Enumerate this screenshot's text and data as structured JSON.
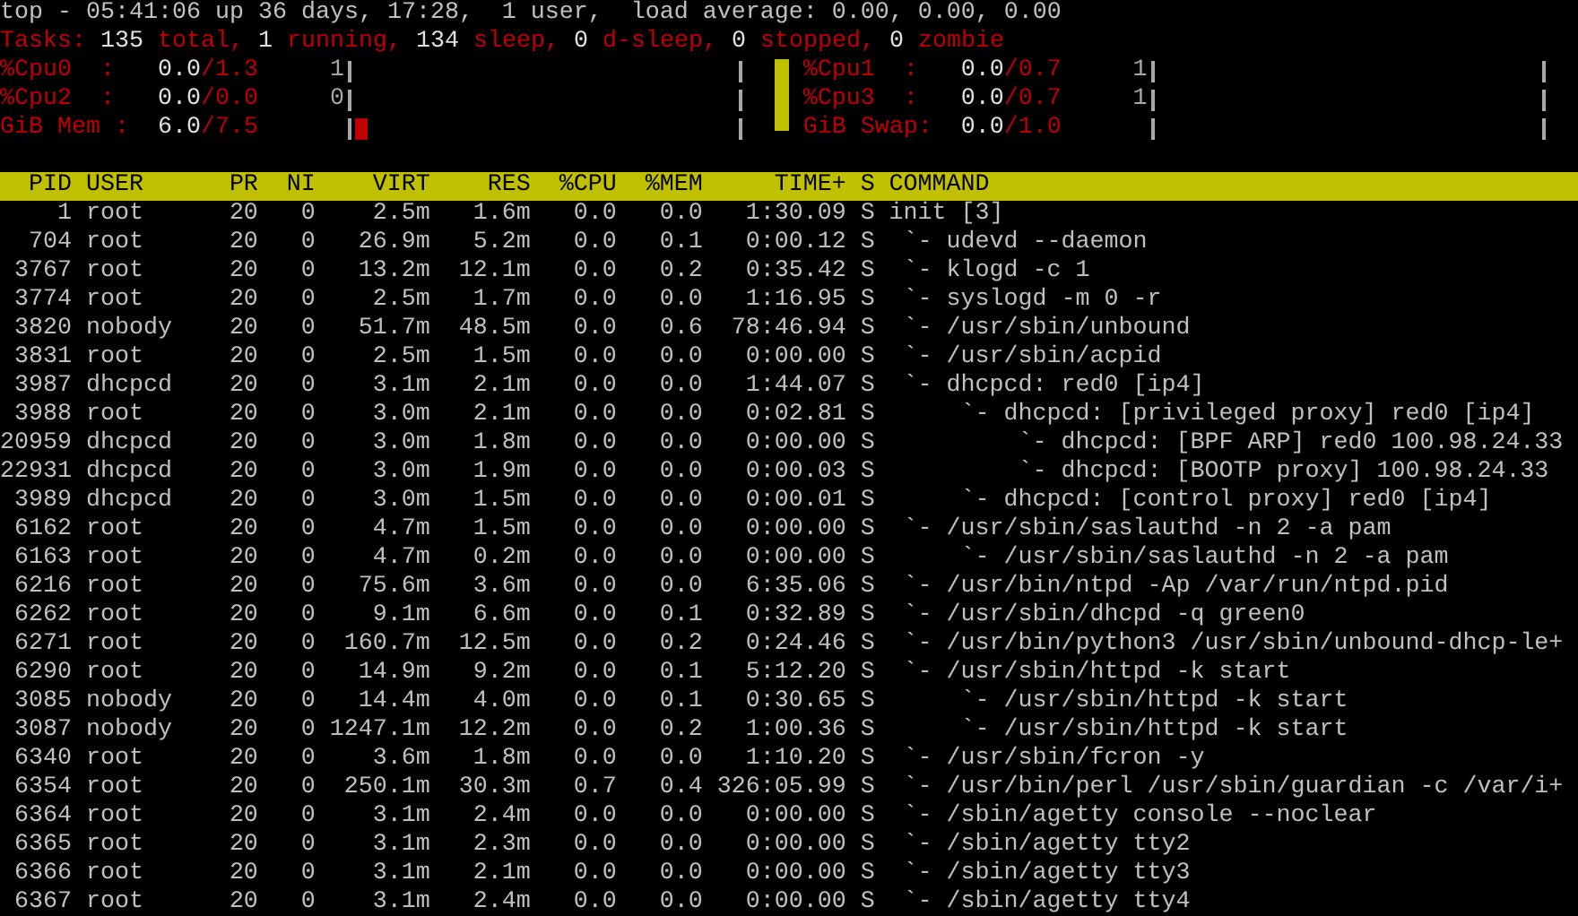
{
  "summary": "top - 05:41:06 up 36 days, 17:28,  1 user,  load average: 0.00, 0.00, 0.00",
  "tasks": {
    "label": "Tasks:",
    "items": [
      {
        "count": "135",
        "text": "total,"
      },
      {
        "count": "1",
        "text": "running,"
      },
      {
        "count": "134",
        "text": "sleep,"
      },
      {
        "count": "0",
        "text": "d-sleep,"
      },
      {
        "count": "0",
        "text": "stopped,"
      },
      {
        "count": "0",
        "text": "zombie"
      }
    ]
  },
  "meters": {
    "left": [
      {
        "label": "%Cpu0  :",
        "value": "0.0",
        "limit": "/1.3",
        "count": "1"
      },
      {
        "label": "%Cpu2  :",
        "value": "0.0",
        "limit": "/0.0",
        "count": "0"
      },
      {
        "label": "GiB Mem :",
        "value": "6.0",
        "limit": "/7.5",
        "level": 0.035
      }
    ],
    "right": [
      {
        "label": "%Cpu1  :",
        "value": "0.0",
        "limit": "/0.7",
        "count": "1"
      },
      {
        "label": "%Cpu3  :",
        "value": "0.0",
        "limit": "/0.7",
        "count": "1"
      },
      {
        "label": "GiB Swap:",
        "value": "0.0",
        "limit": "/1.0"
      }
    ]
  },
  "table": {
    "columns": [
      "PID",
      "USER",
      "PR",
      "NI",
      "VIRT",
      "RES",
      "%CPU",
      "%MEM",
      "TIME+",
      "S",
      "COMMAND"
    ],
    "rows": [
      {
        "pid": "1",
        "user": "root",
        "pr": "20",
        "ni": "0",
        "virt": "2.5m",
        "res": "1.6m",
        "cpu": "0.0",
        "mem": "0.0",
        "time": "1:30.09",
        "s": "S",
        "command": "init [3]",
        "children": [
          {
            "pid": "704",
            "user": "root",
            "pr": "20",
            "ni": "0",
            "virt": "26.9m",
            "res": "5.2m",
            "cpu": "0.0",
            "mem": "0.1",
            "time": "0:00.12",
            "s": "S",
            "command": "`- udevd --daemon"
          },
          {
            "pid": "3767",
            "user": "root",
            "pr": "20",
            "ni": "0",
            "virt": "13.2m",
            "res": "12.1m",
            "cpu": "0.0",
            "mem": "0.2",
            "time": "0:35.42",
            "s": "S",
            "command": "`- klogd -c 1"
          },
          {
            "pid": "3774",
            "user": "root",
            "pr": "20",
            "ni": "0",
            "virt": "2.5m",
            "res": "1.7m",
            "cpu": "0.0",
            "mem": "0.0",
            "time": "1:16.95",
            "s": "S",
            "command": "`- syslogd -m 0 -r"
          },
          {
            "pid": "3820",
            "user": "nobody",
            "pr": "20",
            "ni": "0",
            "virt": "51.7m",
            "res": "48.5m",
            "cpu": "0.0",
            "mem": "0.6",
            "time": "78:46.94",
            "s": "S",
            "command": "`- /usr/sbin/unbound"
          },
          {
            "pid": "3831",
            "user": "root",
            "pr": "20",
            "ni": "0",
            "virt": "2.5m",
            "res": "1.5m",
            "cpu": "0.0",
            "mem": "0.0",
            "time": "0:00.00",
            "s": "S",
            "command": "`- /usr/sbin/acpid"
          },
          {
            "pid": "3987",
            "user": "dhcpcd",
            "pr": "20",
            "ni": "0",
            "virt": "3.1m",
            "res": "2.1m",
            "cpu": "0.0",
            "mem": "0.0",
            "time": "1:44.07",
            "s": "S",
            "command": "`- dhcpcd: red0 [ip4]",
            "children": [
              {
                "pid": "3988",
                "user": "root",
                "pr": "20",
                "ni": "0",
                "virt": "3.0m",
                "res": "2.1m",
                "cpu": "0.0",
                "mem": "0.0",
                "time": "0:02.81",
                "s": "S",
                "command": "`- dhcpcd: [privileged proxy] red0 [ip4]",
                "children": [
                  {
                    "pid": "20959",
                    "user": "dhcpcd",
                    "pr": "20",
                    "ni": "0",
                    "virt": "3.0m",
                    "res": "1.8m",
                    "cpu": "0.0",
                    "mem": "0.0",
                    "time": "0:00.00",
                    "s": "S",
                    "command": "`- dhcpcd: [BPF ARP] red0 100.98.24.33"
                  },
                  {
                    "pid": "22931",
                    "user": "dhcpcd",
                    "pr": "20",
                    "ni": "0",
                    "virt": "3.0m",
                    "res": "1.9m",
                    "cpu": "0.0",
                    "mem": "0.0",
                    "time": "0:00.03",
                    "s": "S",
                    "command": "`- dhcpcd: [BOOTP proxy] 100.98.24.33"
                  }
                ]
              },
              {
                "pid": "3989",
                "user": "dhcpcd",
                "pr": "20",
                "ni": "0",
                "virt": "3.0m",
                "res": "1.5m",
                "cpu": "0.0",
                "mem": "0.0",
                "time": "0:00.01",
                "s": "S",
                "command": "`- dhcpcd: [control proxy] red0 [ip4]"
              }
            ]
          },
          {
            "pid": "6162",
            "user": "root",
            "pr": "20",
            "ni": "0",
            "virt": "4.7m",
            "res": "1.5m",
            "cpu": "0.0",
            "mem": "0.0",
            "time": "0:00.00",
            "s": "S",
            "command": "`- /usr/sbin/saslauthd -n 2 -a pam",
            "children": [
              {
                "pid": "6163",
                "user": "root",
                "pr": "20",
                "ni": "0",
                "virt": "4.7m",
                "res": "0.2m",
                "cpu": "0.0",
                "mem": "0.0",
                "time": "0:00.00",
                "s": "S",
                "command": "`- /usr/sbin/saslauthd -n 2 -a pam"
              }
            ]
          },
          {
            "pid": "6216",
            "user": "root",
            "pr": "20",
            "ni": "0",
            "virt": "75.6m",
            "res": "3.6m",
            "cpu": "0.0",
            "mem": "0.0",
            "time": "6:35.06",
            "s": "S",
            "command": "`- /usr/bin/ntpd -Ap /var/run/ntpd.pid"
          },
          {
            "pid": "6262",
            "user": "root",
            "pr": "20",
            "ni": "0",
            "virt": "9.1m",
            "res": "6.6m",
            "cpu": "0.0",
            "mem": "0.1",
            "time": "0:32.89",
            "s": "S",
            "command": "`- /usr/sbin/dhcpd -q green0"
          },
          {
            "pid": "6271",
            "user": "root",
            "pr": "20",
            "ni": "0",
            "virt": "160.7m",
            "res": "12.5m",
            "cpu": "0.0",
            "mem": "0.2",
            "time": "0:24.46",
            "s": "S",
            "command": "`- /usr/bin/python3 /usr/sbin/unbound-dhcp-le+"
          },
          {
            "pid": "6290",
            "user": "root",
            "pr": "20",
            "ni": "0",
            "virt": "14.9m",
            "res": "9.2m",
            "cpu": "0.0",
            "mem": "0.1",
            "time": "5:12.20",
            "s": "S",
            "command": "`- /usr/sbin/httpd -k start",
            "children": [
              {
                "pid": "3085",
                "user": "nobody",
                "pr": "20",
                "ni": "0",
                "virt": "14.4m",
                "res": "4.0m",
                "cpu": "0.0",
                "mem": "0.1",
                "time": "0:30.65",
                "s": "S",
                "command": "`- /usr/sbin/httpd -k start"
              },
              {
                "pid": "3087",
                "user": "nobody",
                "pr": "20",
                "ni": "0",
                "virt": "1247.1m",
                "res": "12.2m",
                "cpu": "0.0",
                "mem": "0.2",
                "time": "1:00.36",
                "s": "S",
                "command": "`- /usr/sbin/httpd -k start"
              }
            ]
          },
          {
            "pid": "6340",
            "user": "root",
            "pr": "20",
            "ni": "0",
            "virt": "3.6m",
            "res": "1.8m",
            "cpu": "0.0",
            "mem": "0.0",
            "time": "1:10.20",
            "s": "S",
            "command": "`- /usr/sbin/fcron -y"
          },
          {
            "pid": "6354",
            "user": "root",
            "pr": "20",
            "ni": "0",
            "virt": "250.1m",
            "res": "30.3m",
            "cpu": "0.7",
            "mem": "0.4",
            "time": "326:05.99",
            "s": "S",
            "command": "`- /usr/bin/perl /usr/sbin/guardian -c /var/i+"
          },
          {
            "pid": "6364",
            "user": "root",
            "pr": "20",
            "ni": "0",
            "virt": "3.1m",
            "res": "2.4m",
            "cpu": "0.0",
            "mem": "0.0",
            "time": "0:00.00",
            "s": "S",
            "command": "`- /sbin/agetty console --noclear"
          },
          {
            "pid": "6365",
            "user": "root",
            "pr": "20",
            "ni": "0",
            "virt": "3.1m",
            "res": "2.3m",
            "cpu": "0.0",
            "mem": "0.0",
            "time": "0:00.00",
            "s": "S",
            "command": "`- /sbin/agetty tty2"
          },
          {
            "pid": "6366",
            "user": "root",
            "pr": "20",
            "ni": "0",
            "virt": "3.1m",
            "res": "2.1m",
            "cpu": "0.0",
            "mem": "0.0",
            "time": "0:00.00",
            "s": "S",
            "command": "`- /sbin/agetty tty3"
          },
          {
            "pid": "6367",
            "user": "root",
            "pr": "20",
            "ni": "0",
            "virt": "3.1m",
            "res": "2.4m",
            "cpu": "0.0",
            "mem": "0.0",
            "time": "0:00.00",
            "s": "S",
            "command": "`- /sbin/agetty tty4"
          }
        ]
      }
    ]
  }
}
